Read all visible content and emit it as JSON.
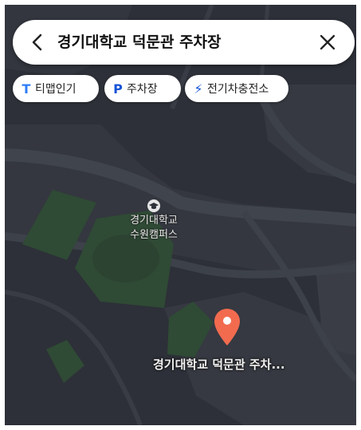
{
  "search": {
    "query": "경기대학교 덕문관 주차장",
    "back_icon": "chevron-left-icon",
    "close_icon": "close-icon"
  },
  "chips": [
    {
      "icon": "tmap-logo-icon",
      "glyph": "T",
      "label": "티맵인기",
      "color": "#2e7df6"
    },
    {
      "icon": "parking-icon",
      "glyph": "P",
      "label": "주차장",
      "color": "#1553d6"
    },
    {
      "icon": "lightning-icon",
      "glyph": "⚡",
      "label": "전기차충전소",
      "color": "#1553d6"
    }
  ],
  "map": {
    "campus_icon": "graduation-cap-icon",
    "campus_label_line1": "경기대학교",
    "campus_label_line2": "수원캠퍼스",
    "place_label": "경기대학교 덕문관 주차...",
    "pin_color": "#f26b4f",
    "background_color": "#2d3038",
    "road_color": "#3c4049",
    "green_color": "#2f4a35"
  }
}
